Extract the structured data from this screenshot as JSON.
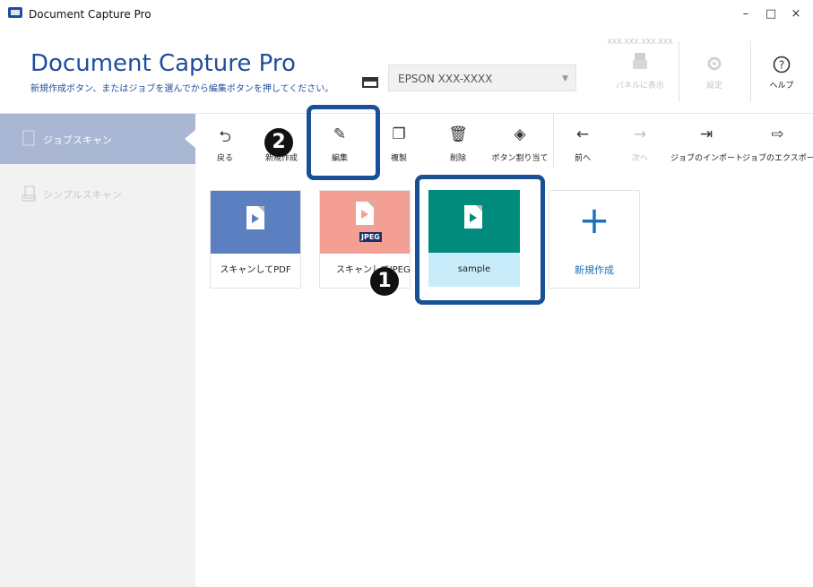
{
  "window": {
    "title": "Document Capture Pro",
    "minimize": "–",
    "maximize": "□",
    "close": "×"
  },
  "header": {
    "app_title": "Document Capture Pro",
    "subtitle": "新規作成ボタン、またはジョブを選んでから編集ボタンを押してください。",
    "scanner": "EPSON XXX-XXXX",
    "ip_address": "XXX.XXX.XXX.XXX",
    "panel_label": "パネルに表示",
    "settings_label": "設定",
    "help_label": "ヘルプ"
  },
  "sidebar": {
    "items": [
      {
        "label": "ジョブスキャン",
        "active": true
      },
      {
        "label": "シンプルスキャン",
        "active": false
      }
    ]
  },
  "toolbar": {
    "back": "戻る",
    "create": "新規作成",
    "edit": "編集",
    "duplicate": "複製",
    "delete": "削除",
    "assign": "ボタン割り当て",
    "prev": "前へ",
    "next": "次へ",
    "import": "ジョブのインポート",
    "export": "ジョブのエクスポート"
  },
  "jobs": [
    {
      "name": "スキャンしてPDF",
      "color": "#5b7fc1"
    },
    {
      "name": "スキャンしてJPEG",
      "badge": "JPEG",
      "color": "#f49f94"
    },
    {
      "name": "sample",
      "color": "#008b7c",
      "selected": true
    },
    {
      "name": "新規作成",
      "color": "#1f6fbd"
    }
  ],
  "callouts": {
    "one": "1",
    "two": "2"
  },
  "colors": {
    "brand": "#1f4e9c",
    "sidebar_active": "#a9b7d4",
    "highlight": "#1a5196",
    "selected_tile": "#c9ecfa"
  }
}
